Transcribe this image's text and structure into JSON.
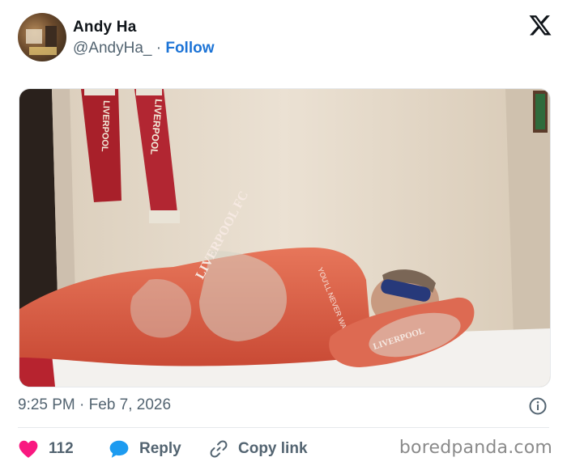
{
  "tweet": {
    "author_name": "Andy Ha",
    "handle": "@AndyHa_",
    "separator": " · ",
    "follow_label": "Follow",
    "timestamp": "9:25 PM · Feb 7, 2026",
    "likes_count": "112",
    "reply_label": "Reply",
    "copy_link_label": "Copy link"
  },
  "photo": {
    "scarf_left_text": "LIVERPOOL",
    "scarf_right_text": "LIVERPOOL",
    "duvet_text": "LIVERPOOL FC",
    "duvet_motto": "YOU'LL NEVER WALK ALONE",
    "pillow_text": "LIVERPOOL"
  },
  "watermark": "boredpanda.com",
  "icons": {
    "brand": "x-logo-icon",
    "info": "info-icon",
    "like": "heart-icon",
    "reply": "reply-bubble-icon",
    "copy": "link-icon"
  },
  "colors": {
    "follow_link": "#1d74d6",
    "heart": "#f91880",
    "reply_bubble": "#1d9bf0",
    "muted_text": "#536471"
  }
}
